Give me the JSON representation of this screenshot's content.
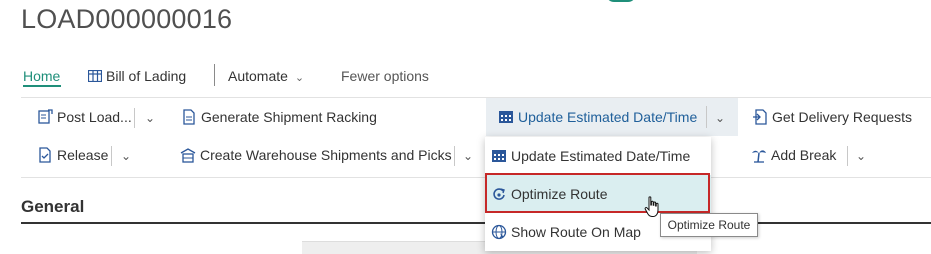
{
  "page": {
    "title": "LOAD000000016"
  },
  "nav": {
    "home": "Home",
    "bill_of_lading": "Bill of Lading",
    "automate": "Automate",
    "fewer_options": "Fewer options"
  },
  "actions": {
    "post_load": "Post Load...",
    "generate_racking": "Generate Shipment Racking",
    "update_date_time": "Update Estimated Date/Time",
    "get_delivery": "Get Delivery Requests",
    "release": "Release",
    "create_wh_shipments": "Create Warehouse Shipments and Picks",
    "add_break": "Add Break"
  },
  "dropdown": {
    "items": [
      {
        "label": "Update Estimated Date/Time",
        "icon": "calendar-icon"
      },
      {
        "label": "Optimize Route",
        "icon": "route-icon",
        "highlighted": true
      },
      {
        "label": "Show Route On Map",
        "icon": "globe-icon"
      }
    ]
  },
  "tooltip": "Optimize Route",
  "section": {
    "title": "General"
  },
  "colors": {
    "accent": "#1f8f7a",
    "highlight": "#daeef0",
    "focus_border": "#c62828"
  }
}
